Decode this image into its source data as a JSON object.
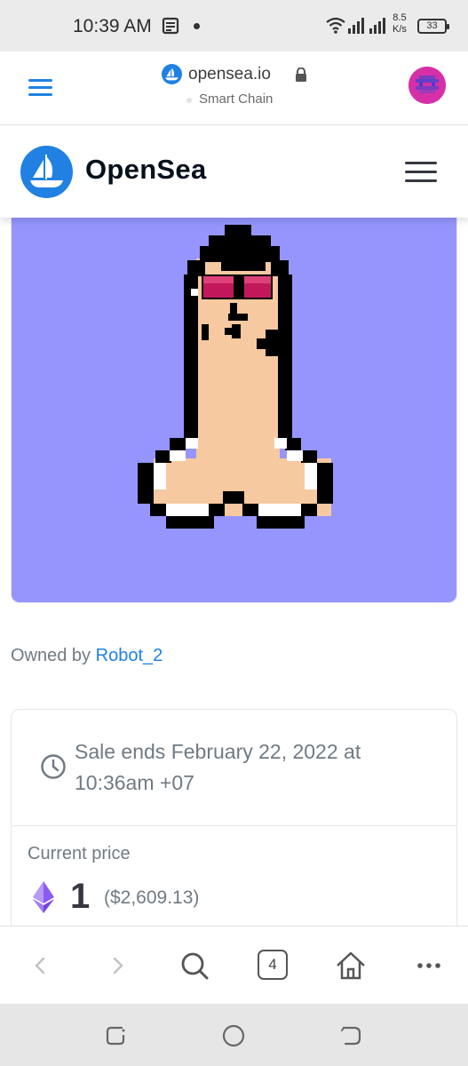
{
  "status_bar": {
    "time": "10:39 AM",
    "net_speed_value": "8.5",
    "net_speed_unit": "K/s",
    "battery": "33"
  },
  "browser": {
    "domain": "opensea.io",
    "network": "Smart Chain",
    "tab_count": "4",
    "accent": "#2081e2"
  },
  "site": {
    "brand": "OpenSea"
  },
  "nft": {
    "background_color": "#9595fd",
    "owned_prefix": "Owned by",
    "owner": "Robot_2"
  },
  "sale": {
    "ends_text": "Sale ends February 22, 2022 at 10:36am +07",
    "current_price_label": "Current price",
    "price": "1",
    "price_usd": "($2,609.13)"
  },
  "icons": {
    "status": [
      "notification-icon",
      "wifi-icon",
      "signal-icon",
      "battery-icon"
    ],
    "toolbar": [
      "back-icon",
      "forward-icon",
      "search-icon",
      "tabs-icon",
      "home-icon",
      "more-icon"
    ],
    "nav": [
      "recents-icon",
      "home-circle-icon",
      "back-nav-icon"
    ]
  }
}
